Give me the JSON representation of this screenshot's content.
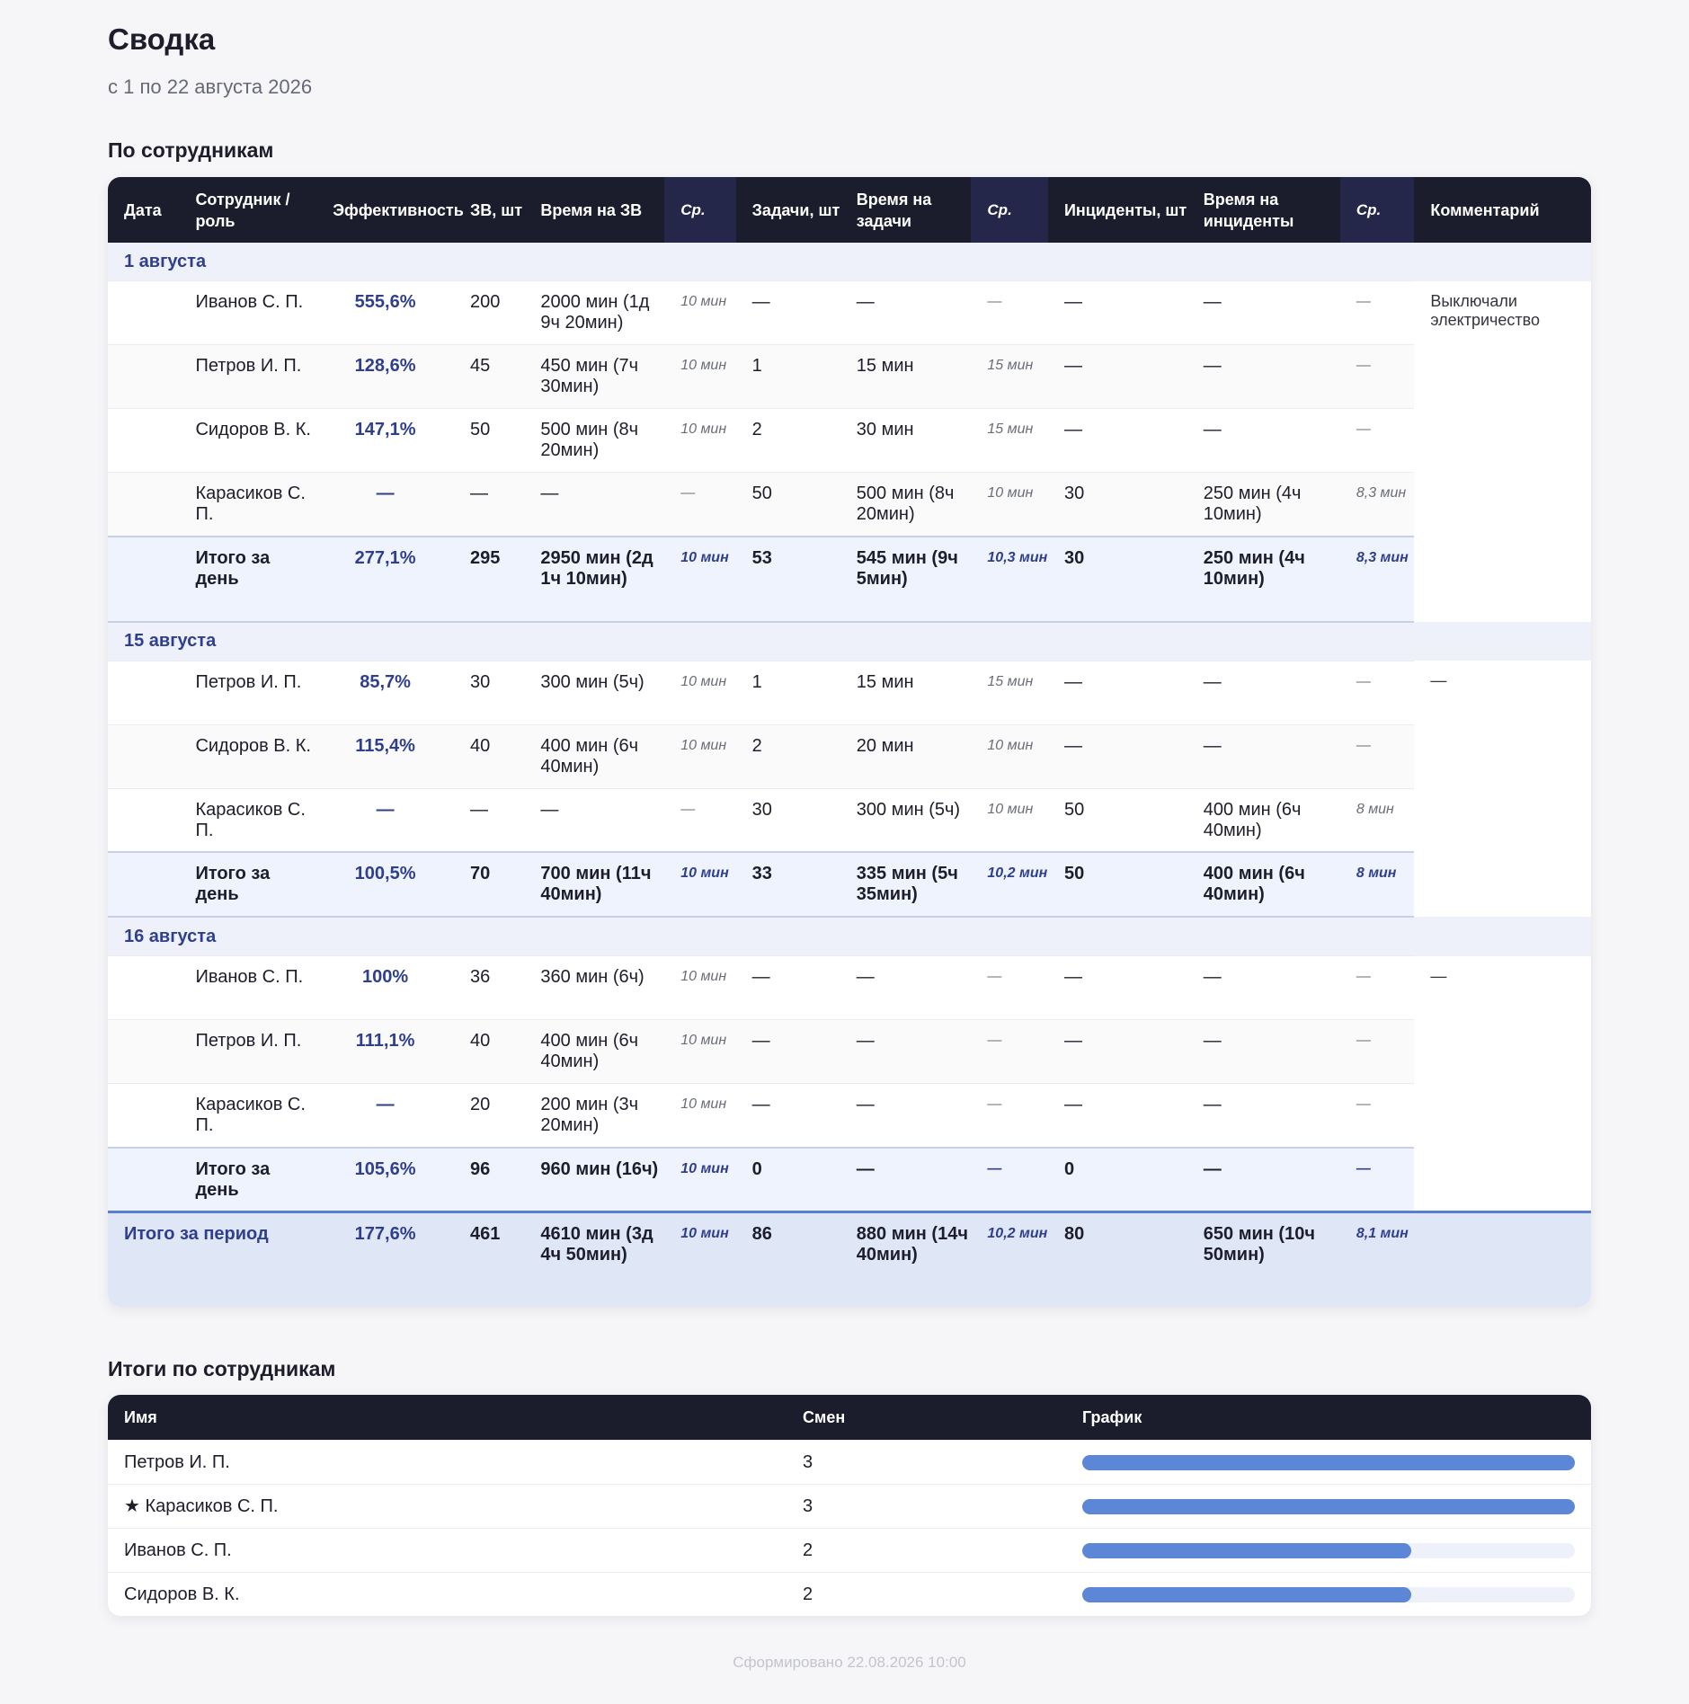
{
  "title": "Сводка",
  "period": "с 1 по 22 августа 2026",
  "section1_title": "По сотрудникам",
  "section2_title": "Итоги по сотрудникам",
  "accent_color": "#2f3f8e",
  "bar_color": "#5b87d6",
  "main_table": {
    "headers": {
      "date": "Дата",
      "employee": "Сотрудник / роль",
      "efficiency": "Эффективность",
      "zv_count": "ЗВ, шт",
      "zv_time": "Время на ЗВ",
      "avg1": "Ср.",
      "tasks": "Задачи, шт",
      "tasks_time": "Время на задачи",
      "avg2": "Ср.",
      "incidents": "Инциденты, шт",
      "incidents_time": "Время на инциденты",
      "avg3": "Ср.",
      "comment": "Комментарий"
    },
    "groups": [
      {
        "date": "1 августа",
        "comment": "Выключали электричество",
        "rows": [
          {
            "name": "Иванов С. П.",
            "eff": "555,6%",
            "zv": "200",
            "zv_time": "2000 мин (1д 9ч 20мин)",
            "avg1": "10 мин",
            "tasks": "—",
            "tasks_time": "—",
            "avg2": "—",
            "inc": "—",
            "inc_time": "—",
            "avg3": "—"
          },
          {
            "name": "Петров И. П.",
            "eff": "128,6%",
            "zv": "45",
            "zv_time": "450 мин (7ч 30мин)",
            "avg1": "10 мин",
            "tasks": "1",
            "tasks_time": "15 мин",
            "avg2": "15 мин",
            "inc": "—",
            "inc_time": "—",
            "avg3": "—"
          },
          {
            "name": "Сидоров В. К.",
            "eff": "147,1%",
            "zv": "50",
            "zv_time": "500 мин (8ч 20мин)",
            "avg1": "10 мин",
            "tasks": "2",
            "tasks_time": "30 мин",
            "avg2": "15 мин",
            "inc": "—",
            "inc_time": "—",
            "avg3": "—"
          },
          {
            "name": "Карасиков С. П.",
            "eff": "—",
            "zv": "—",
            "zv_time": "—",
            "avg1": "—",
            "tasks": "50",
            "tasks_time": "500 мин (8ч 20мин)",
            "avg2": "10 мин",
            "inc": "30",
            "inc_time": "250 мин (4ч 10мин)",
            "avg3": "8,3 мин"
          }
        ],
        "total": {
          "label": "Итого за день",
          "eff": "277,1%",
          "zv": "295",
          "zv_time": "2950 мин (2д 1ч 10мин)",
          "avg1": "10 мин",
          "tasks": "53",
          "tasks_time": "545 мин (9ч 5мин)",
          "avg2": "10,3 мин",
          "inc": "30",
          "inc_time": "250 мин (4ч 10мин)",
          "avg3": "8,3 мин"
        }
      },
      {
        "date": "15 августа",
        "comment": "—",
        "rows": [
          {
            "name": "Петров И. П.",
            "eff": "85,7%",
            "zv": "30",
            "zv_time": "300 мин (5ч)",
            "avg1": "10 мин",
            "tasks": "1",
            "tasks_time": "15 мин",
            "avg2": "15 мин",
            "inc": "—",
            "inc_time": "—",
            "avg3": "—"
          },
          {
            "name": "Сидоров В. К.",
            "eff": "115,4%",
            "zv": "40",
            "zv_time": "400 мин (6ч 40мин)",
            "avg1": "10 мин",
            "tasks": "2",
            "tasks_time": "20 мин",
            "avg2": "10 мин",
            "inc": "—",
            "inc_time": "—",
            "avg3": "—"
          },
          {
            "name": "Карасиков С. П.",
            "eff": "—",
            "zv": "—",
            "zv_time": "—",
            "avg1": "—",
            "tasks": "30",
            "tasks_time": "300 мин (5ч)",
            "avg2": "10 мин",
            "inc": "50",
            "inc_time": "400 мин (6ч 40мин)",
            "avg3": "8 мин"
          }
        ],
        "total": {
          "label": "Итого за день",
          "eff": "100,5%",
          "zv": "70",
          "zv_time": "700 мин (11ч 40мин)",
          "avg1": "10 мин",
          "tasks": "33",
          "tasks_time": "335 мин (5ч 35мин)",
          "avg2": "10,2 мин",
          "inc": "50",
          "inc_time": "400 мин (6ч 40мин)",
          "avg3": "8 мин"
        }
      },
      {
        "date": "16 августа",
        "comment": "—",
        "rows": [
          {
            "name": "Иванов С. П.",
            "eff": "100%",
            "zv": "36",
            "zv_time": "360 мин (6ч)",
            "avg1": "10 мин",
            "tasks": "—",
            "tasks_time": "—",
            "avg2": "—",
            "inc": "—",
            "inc_time": "—",
            "avg3": "—"
          },
          {
            "name": "Петров И. П.",
            "eff": "111,1%",
            "zv": "40",
            "zv_time": "400 мин (6ч 40мин)",
            "avg1": "10 мин",
            "tasks": "—",
            "tasks_time": "—",
            "avg2": "—",
            "inc": "—",
            "inc_time": "—",
            "avg3": "—"
          },
          {
            "name": "Карасиков С. П.",
            "eff": "—",
            "zv": "20",
            "zv_time": "200 мин (3ч 20мин)",
            "avg1": "10 мин",
            "tasks": "—",
            "tasks_time": "—",
            "avg2": "—",
            "inc": "—",
            "inc_time": "—",
            "avg3": "—"
          }
        ],
        "total": {
          "label": "Итого за день",
          "eff": "105,6%",
          "zv": "96",
          "zv_time": "960 мин (16ч)",
          "avg1": "10 мин",
          "tasks": "0",
          "tasks_time": "—",
          "avg2": "—",
          "inc": "0",
          "inc_time": "—",
          "avg3": "—"
        }
      }
    ],
    "period_total": {
      "label": "Итого за период",
      "eff": "177,6%",
      "zv": "461",
      "zv_time": "4610 мин (3д 4ч 50мин)",
      "avg1": "10 мин",
      "tasks": "86",
      "tasks_time": "880 мин (14ч 40мин)",
      "avg2": "10,2 мин",
      "inc": "80",
      "inc_time": "650 мин (10ч 50мин)",
      "avg3": "8,1 мин"
    }
  },
  "summary_table": {
    "headers": {
      "name": "Имя",
      "shifts": "Смен",
      "chart": "График"
    },
    "rows": [
      {
        "name": "Петров И. П.",
        "shifts": "3",
        "fraction": 1.0
      },
      {
        "name": "★ Карасиков С. П.",
        "shifts": "3",
        "fraction": 1.0
      },
      {
        "name": "Иванов С. П.",
        "shifts": "2",
        "fraction": 0.667
      },
      {
        "name": "Сидоров В. К.",
        "shifts": "2",
        "fraction": 0.667
      }
    ]
  },
  "footer": "Сформировано 22.08.2026 10:00"
}
